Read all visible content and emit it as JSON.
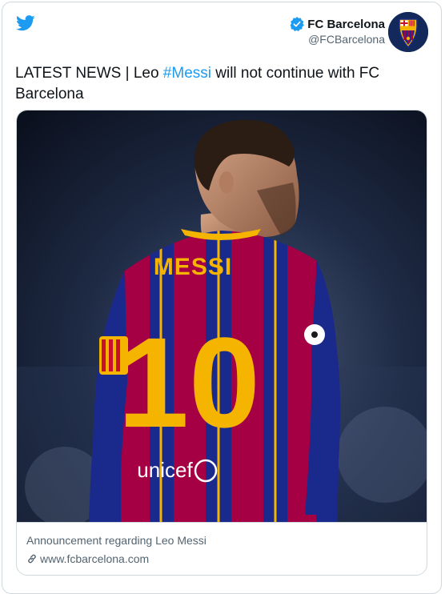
{
  "tweet": {
    "author_name": "FC Barcelona",
    "author_handle": "@FCBarcelona",
    "text_before": "LATEST NEWS | Leo ",
    "hashtag": "#Messi",
    "text_after": " will not continue with FC Barcelona"
  },
  "card": {
    "title": "Announcement regarding Leo Messi",
    "domain": "www.fcbarcelona.com"
  },
  "photo": {
    "jersey_name": "MESSI",
    "jersey_number": "10",
    "sponsor": "unicef"
  },
  "colors": {
    "accent": "#1d9bf0",
    "club_blue": "#1a2a8c",
    "club_red": "#a50044",
    "club_gold": "#f5b400"
  },
  "icons": [
    "twitter-bird-icon",
    "verified-badge-icon",
    "fcb-crest-icon",
    "link-icon"
  ]
}
